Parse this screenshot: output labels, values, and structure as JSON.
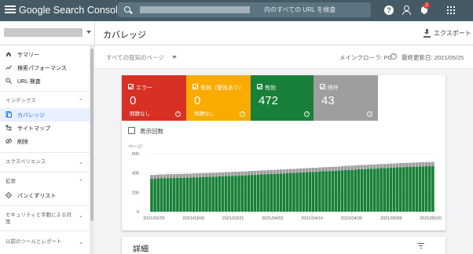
{
  "topbar": {
    "brand": "Google Search Console",
    "search_placeholder": "内のすべての URL を検査",
    "help": "?",
    "notification_count": "2"
  },
  "header": {
    "page_title": "カバレッジ",
    "export_label": "エクスポート"
  },
  "sidebar": {
    "items": [
      {
        "label": "サマリー",
        "icon": "home-icon"
      },
      {
        "label": "検索パフォーマンス",
        "icon": "trending-up-icon"
      },
      {
        "label": "URL 検査",
        "icon": "search-icon"
      }
    ],
    "sections": [
      {
        "label": "インデックス",
        "chevron": "up"
      },
      {
        "label": "エクスペリエンス",
        "chevron": "down"
      },
      {
        "label": "拡張",
        "chevron": "up"
      },
      {
        "label": "セキュリティと手動による対策",
        "chevron": "down"
      },
      {
        "label": "以前のツールとレポート",
        "chevron": "down"
      }
    ],
    "index_items": [
      {
        "label": "カバレッジ",
        "icon": "coverage-icon",
        "active": true
      },
      {
        "label": "サイトマップ",
        "icon": "sitemap-icon"
      },
      {
        "label": "削除",
        "icon": "remove-eye-icon"
      }
    ],
    "enh_items": [
      {
        "label": "パンくずリスト",
        "icon": "breadcrumb-icon"
      }
    ]
  },
  "filter": {
    "label": "すべての既知のページ",
    "crawler": "メインクローラ: PC",
    "updated": "最終更新日: 2021/05/25"
  },
  "tiles": [
    {
      "label": "エラー",
      "value": "0",
      "sub": "問題なし",
      "color": "#d93025"
    },
    {
      "label": "有効（警告あり）",
      "value": "0",
      "sub": "問題なし",
      "color": "#f9ab00"
    },
    {
      "label": "有効",
      "value": "472",
      "sub": "",
      "color": "#188038"
    },
    {
      "label": "除外",
      "value": "43",
      "sub": "",
      "color": "#9e9e9e"
    }
  ],
  "show_impressions": "表示回数",
  "details_label": "詳細",
  "chart_data": {
    "type": "bar",
    "ylabel": "ページ",
    "yticks": [
      0,
      200,
      400,
      600
    ],
    "ylim": [
      0,
      600
    ],
    "x_tick_labels": [
      "2021/02/25",
      "2021/03/09",
      "2021/03/21",
      "2021/04/02",
      "2021/04/14",
      "2021/04/26",
      "2021/05/08",
      "2021/05/20"
    ],
    "series": [
      {
        "color": "#188038",
        "values": [
          340,
          340,
          345,
          345,
          345,
          348,
          348,
          348,
          350,
          350,
          350,
          352,
          352,
          355,
          355,
          358,
          358,
          360,
          360,
          362,
          362,
          365,
          365,
          368,
          368,
          370,
          372,
          372,
          375,
          375,
          378,
          380,
          380,
          382,
          385,
          385,
          388,
          390,
          390,
          392,
          395,
          395,
          398,
          400,
          400,
          402,
          405,
          405,
          408,
          410,
          412,
          412,
          415,
          418,
          418,
          420,
          422,
          422,
          425,
          428,
          430,
          432,
          432,
          435,
          438,
          440,
          440,
          442,
          445,
          445,
          448,
          450,
          450,
          452,
          455,
          455,
          458,
          460,
          460,
          462,
          462,
          465,
          465,
          468,
          468,
          470,
          470,
          472
        ]
      },
      {
        "color": "#9e9e9e",
        "values": [
          40,
          40,
          40,
          40,
          40,
          40,
          40,
          40,
          40,
          40,
          40,
          40,
          40,
          40,
          40,
          40,
          40,
          41,
          41,
          41,
          41,
          41,
          41,
          41,
          41,
          41,
          41,
          41,
          41,
          41,
          41,
          41,
          42,
          42,
          42,
          42,
          42,
          42,
          42,
          42,
          42,
          42,
          42,
          42,
          42,
          42,
          42,
          42,
          42,
          42,
          42,
          42,
          42,
          42,
          42,
          42,
          42,
          42,
          42,
          42,
          43,
          43,
          43,
          43,
          43,
          43,
          43,
          43,
          43,
          43,
          43,
          43,
          43,
          43,
          43,
          43,
          43,
          43,
          43,
          43,
          43,
          43,
          43,
          43,
          43,
          43,
          43,
          43
        ]
      }
    ]
  }
}
